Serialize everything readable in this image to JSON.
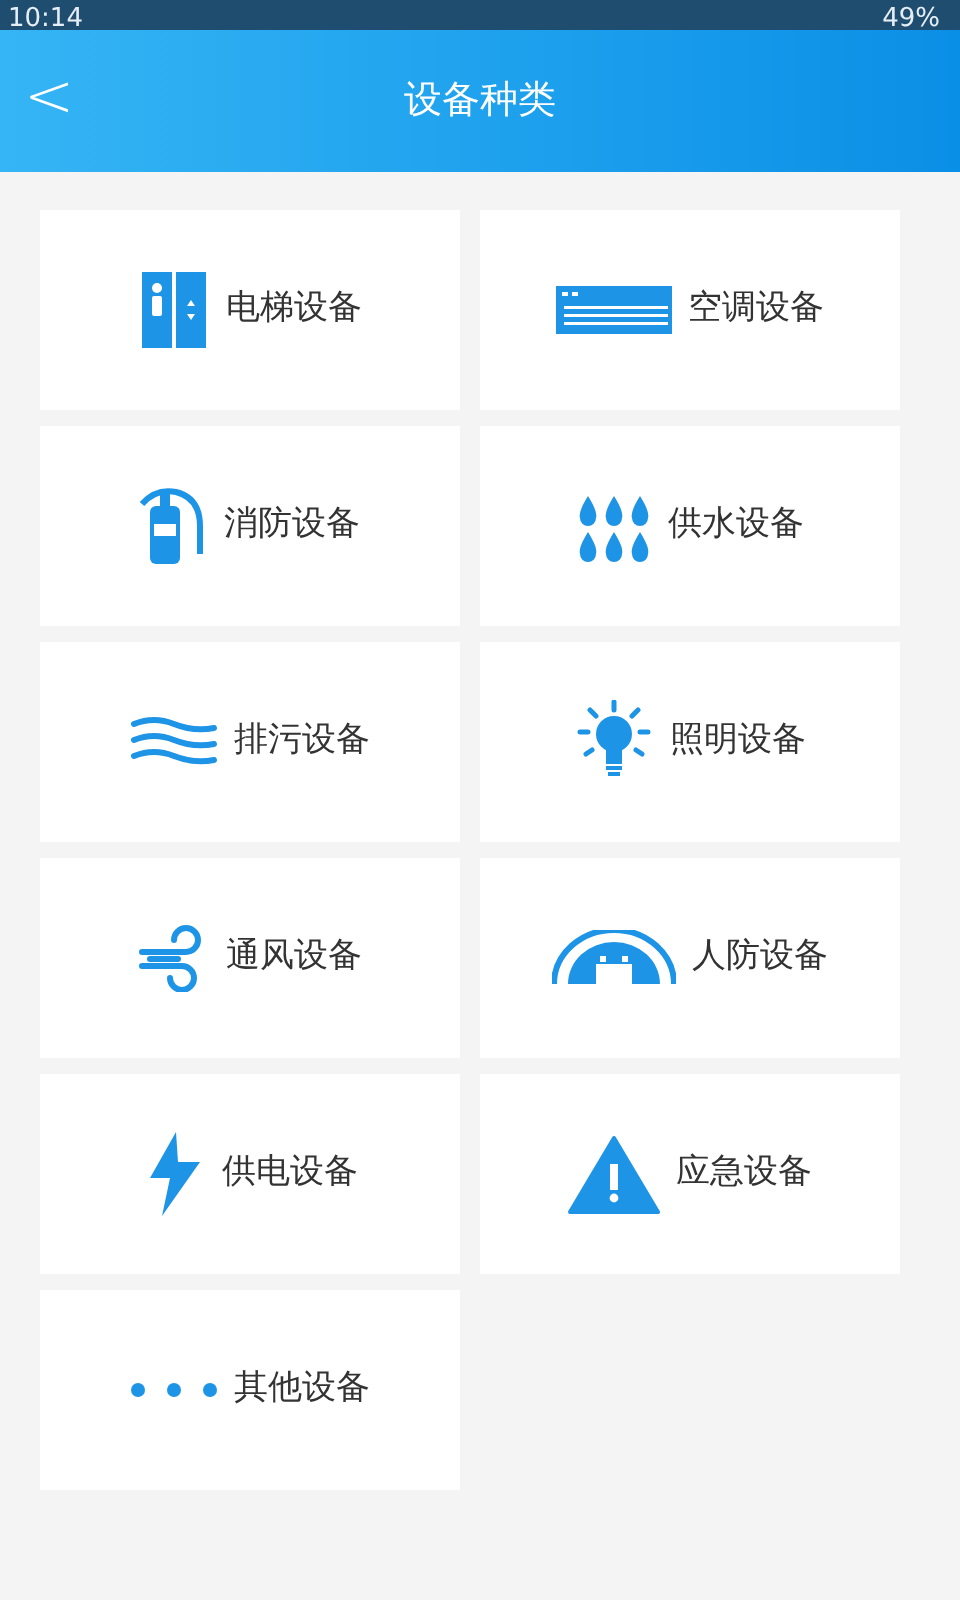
{
  "status_bar": {
    "time": "10:14",
    "battery": "49%"
  },
  "header": {
    "back": "<",
    "title": "设备种类"
  },
  "categories": [
    {
      "label": "电梯设备"
    },
    {
      "label": "空调设备"
    },
    {
      "label": "消防设备"
    },
    {
      "label": "供水设备"
    },
    {
      "label": "排污设备"
    },
    {
      "label": "照明设备"
    },
    {
      "label": "通风设备"
    },
    {
      "label": "人防设备"
    },
    {
      "label": "供电设备"
    },
    {
      "label": "应急设备"
    },
    {
      "label": "其他设备"
    }
  ]
}
